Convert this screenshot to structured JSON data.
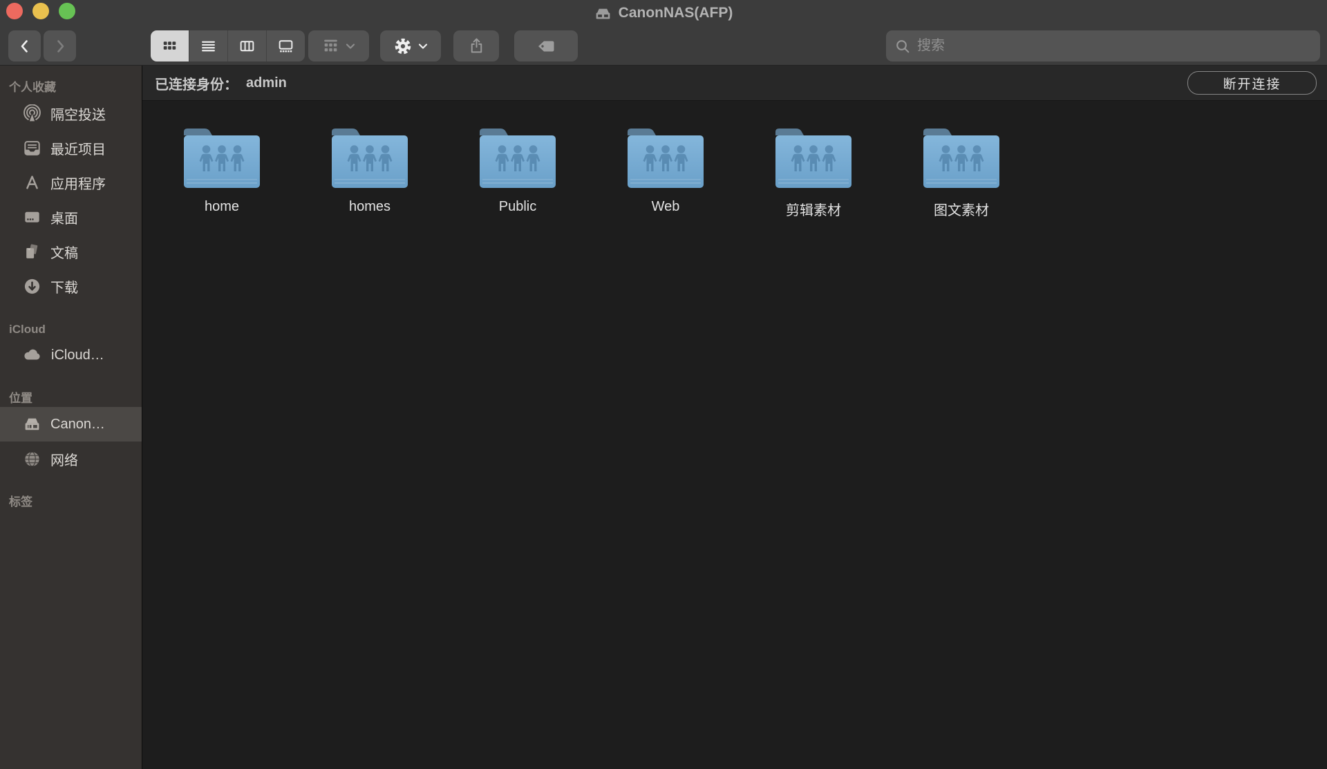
{
  "window": {
    "title": "CanonNAS(AFP)"
  },
  "colors": {
    "traffic_close": "#ed6a5f",
    "traffic_minimize": "#e9c04e",
    "traffic_zoom": "#67c254",
    "folder_blue_top": "#84b6db",
    "folder_blue_bottom": "#6aa0c9",
    "selected_segment": "#d5d5d5",
    "sidebar_bg": "#353230",
    "toolbar_bg": "#3c3c3c"
  },
  "toolbar": {
    "search_placeholder": "搜索",
    "view_modes": [
      "icon-view",
      "list-view",
      "column-view",
      "gallery-view"
    ],
    "selected_view": "icon-view"
  },
  "statusbar": {
    "connected_label": "已连接身份：",
    "user": "admin",
    "disconnect_label": "断开连接"
  },
  "sidebar": {
    "sections": [
      {
        "header": "个人收藏",
        "items": [
          {
            "label": "隔空投送",
            "icon": "airdrop-icon"
          },
          {
            "label": "最近项目",
            "icon": "recents-icon"
          },
          {
            "label": "应用程序",
            "icon": "applications-icon"
          },
          {
            "label": "桌面",
            "icon": "desktop-icon"
          },
          {
            "label": "文稿",
            "icon": "documents-icon"
          },
          {
            "label": "下载",
            "icon": "downloads-icon"
          }
        ]
      },
      {
        "header": "iCloud",
        "items": [
          {
            "label": "iCloud…",
            "icon": "icloud-icon"
          }
        ]
      },
      {
        "header": "位置",
        "items": [
          {
            "label": "Canon…",
            "icon": "nas-icon",
            "selected": true
          },
          {
            "label": "网络",
            "icon": "network-globe-icon"
          }
        ]
      },
      {
        "header": "标签",
        "items": []
      }
    ]
  },
  "main": {
    "folders": [
      {
        "name": "home"
      },
      {
        "name": "homes"
      },
      {
        "name": "Public"
      },
      {
        "name": "Web"
      },
      {
        "name": "剪辑素材"
      },
      {
        "name": "图文素材"
      }
    ]
  }
}
